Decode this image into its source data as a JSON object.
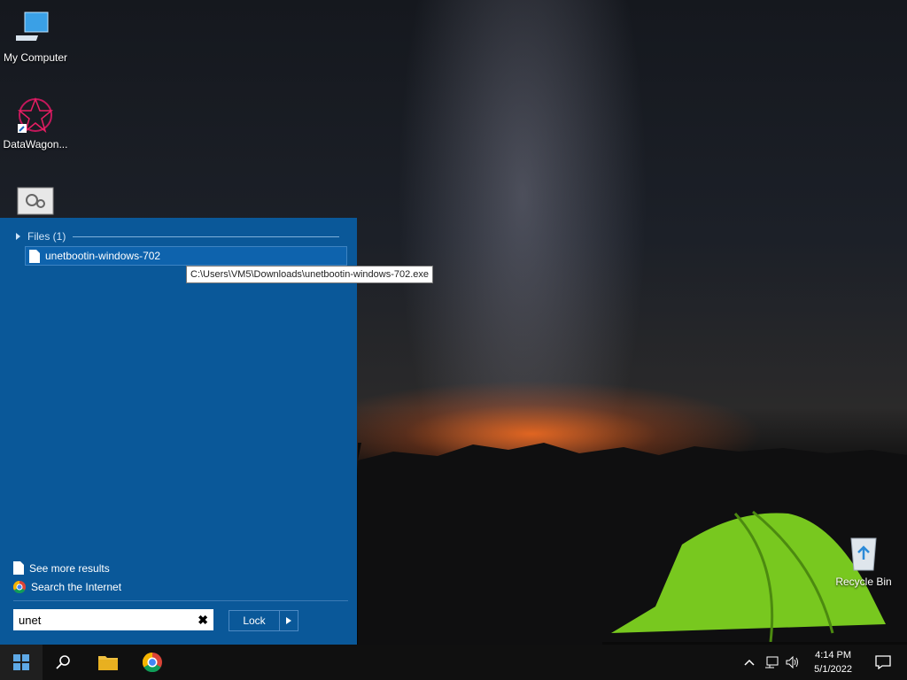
{
  "desktop": {
    "icons": [
      {
        "label": "My Computer"
      },
      {
        "label": "DataWagon..."
      },
      {
        "label": ""
      },
      {
        "label": "Recycle Bin"
      }
    ]
  },
  "start_menu": {
    "files_header": "Files (1)",
    "result": {
      "label": "unetbootin-windows-702"
    },
    "tooltip": "C:\\Users\\VM5\\Downloads\\unetbootin-windows-702.exe",
    "see_more": "See more results",
    "search_internet": "Search the Internet",
    "search": {
      "value": "unet"
    },
    "lock_label": "Lock"
  },
  "taskbar": {
    "clock": {
      "time": "4:14 PM",
      "date": "5/1/2022"
    },
    "icons": [
      "windows-start-icon",
      "search-icon",
      "file-explorer-icon",
      "chrome-icon"
    ],
    "tray_icons": [
      "chevron-up-icon",
      "network-icon",
      "volume-icon",
      "notification-icon"
    ]
  },
  "colors": {
    "panel": "#0a5899",
    "taskbar": "#101010",
    "tent": "#7ed321"
  }
}
